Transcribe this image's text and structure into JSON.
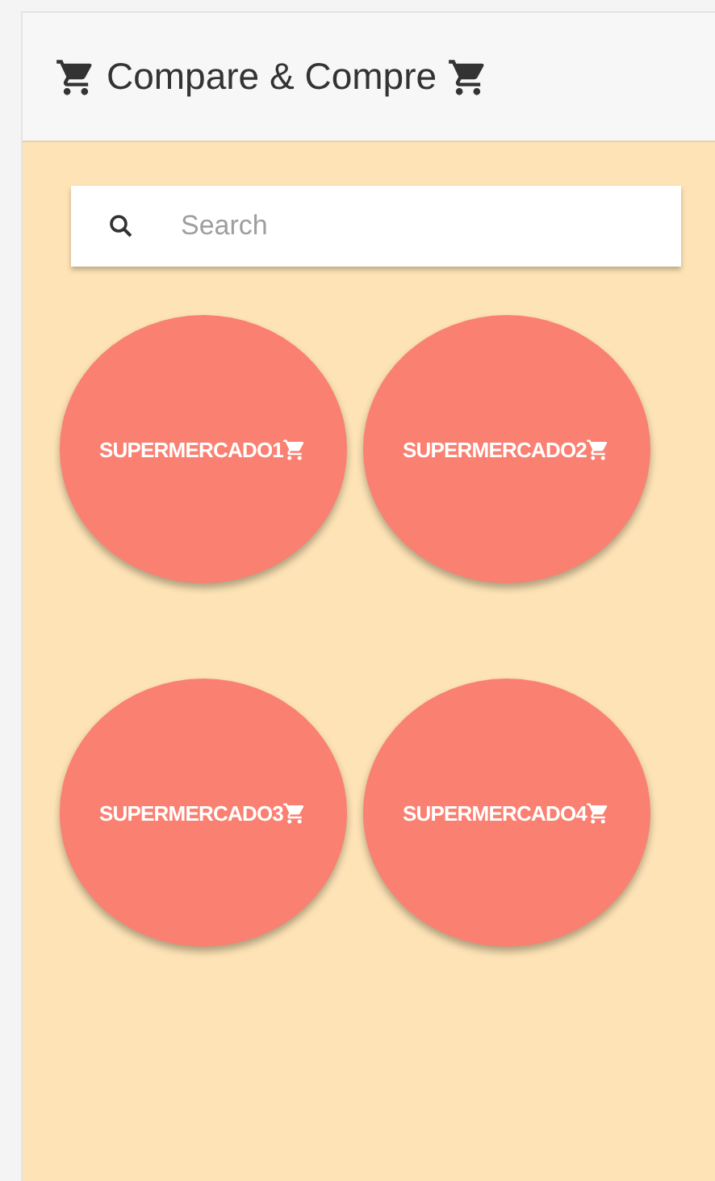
{
  "header": {
    "title": "Compare & Compre"
  },
  "search": {
    "placeholder": "Search"
  },
  "stores": [
    {
      "name": "SUPERMERCADO1"
    },
    {
      "name": "SUPERMERCADO2"
    },
    {
      "name": "SUPERMERCADO3"
    },
    {
      "name": "SUPERMERCADO4"
    }
  ]
}
